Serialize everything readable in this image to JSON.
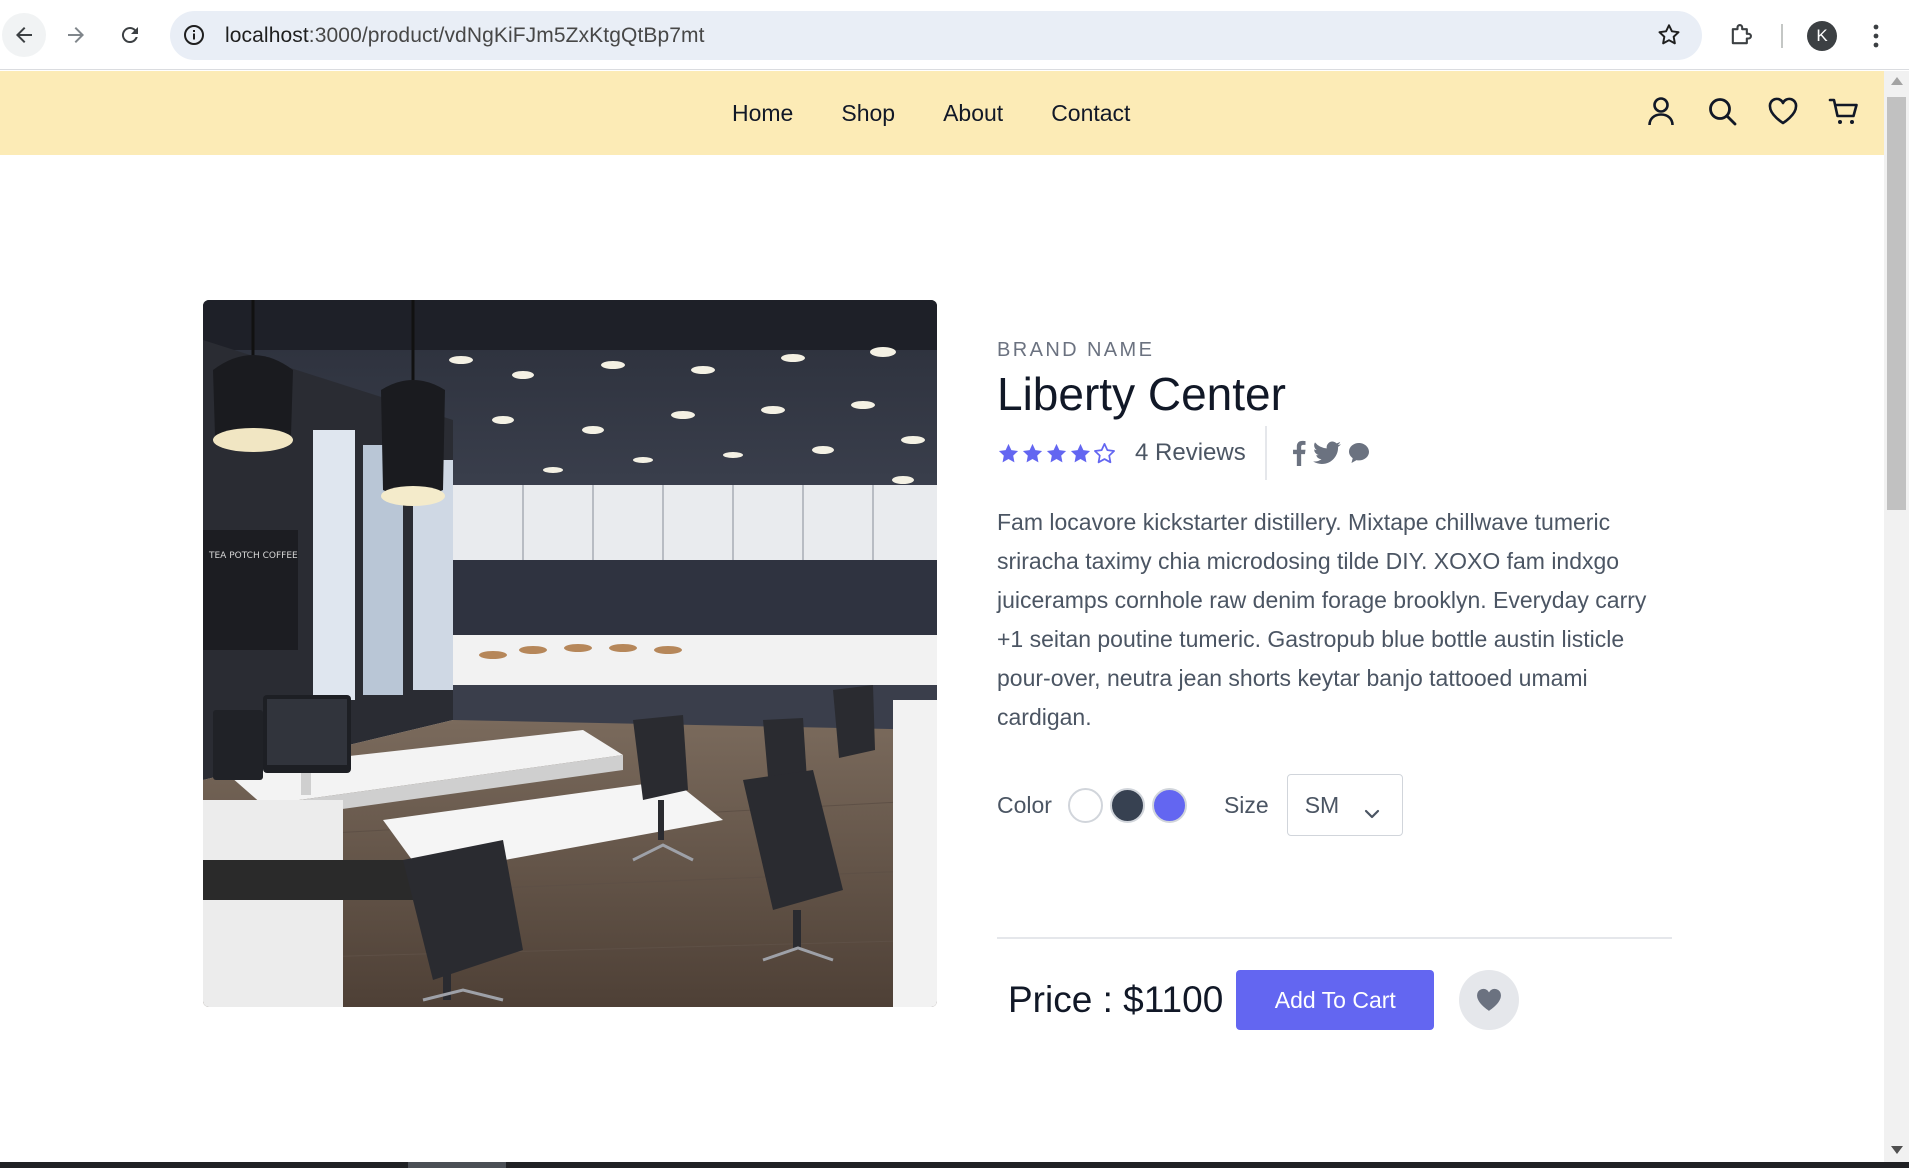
{
  "browser": {
    "url_host": "localhost",
    "url_path": ":3000/product/vdNgKiFJm5ZxKtgQtBp7mt",
    "profile_initial": "K",
    "icons": [
      "back-arrow-icon",
      "forward-arrow-icon",
      "reload-icon",
      "site-info-icon",
      "bookmark-star-icon",
      "extensions-icon",
      "menu-kebab-icon"
    ]
  },
  "header": {
    "nav": [
      "Home",
      "Shop",
      "About",
      "Contact"
    ],
    "icons": [
      "user-icon",
      "search-icon",
      "heart-icon",
      "cart-icon"
    ],
    "background_color": "#fcebb6"
  },
  "product": {
    "brand": "BRAND NAME",
    "title": "Liberty Center",
    "rating": 4,
    "rating_max": 5,
    "reviews": "4 Reviews",
    "social_icons": [
      "facebook-icon",
      "twitter-icon",
      "chat-icon"
    ],
    "description": "Fam locavore kickstarter distillery. Mixtape chillwave tumeric sriracha taximy chia microdosing tilde DIY. XOXO fam indxgo juiceramps cornhole raw denim forage brooklyn. Everyday carry +1 seitan poutine tumeric. Gastropub blue bottle austin listicle pour-over, neutra jean shorts keytar banjo tattooed umami cardigan.",
    "color_label": "Color",
    "colors": [
      "#ffffff",
      "#374151",
      "#6366f1"
    ],
    "size_label": "Size",
    "size_selected": "SM",
    "price": "Price : $1100",
    "add_to_cart": "Add To Cart",
    "accent_color": "#6366f1"
  }
}
